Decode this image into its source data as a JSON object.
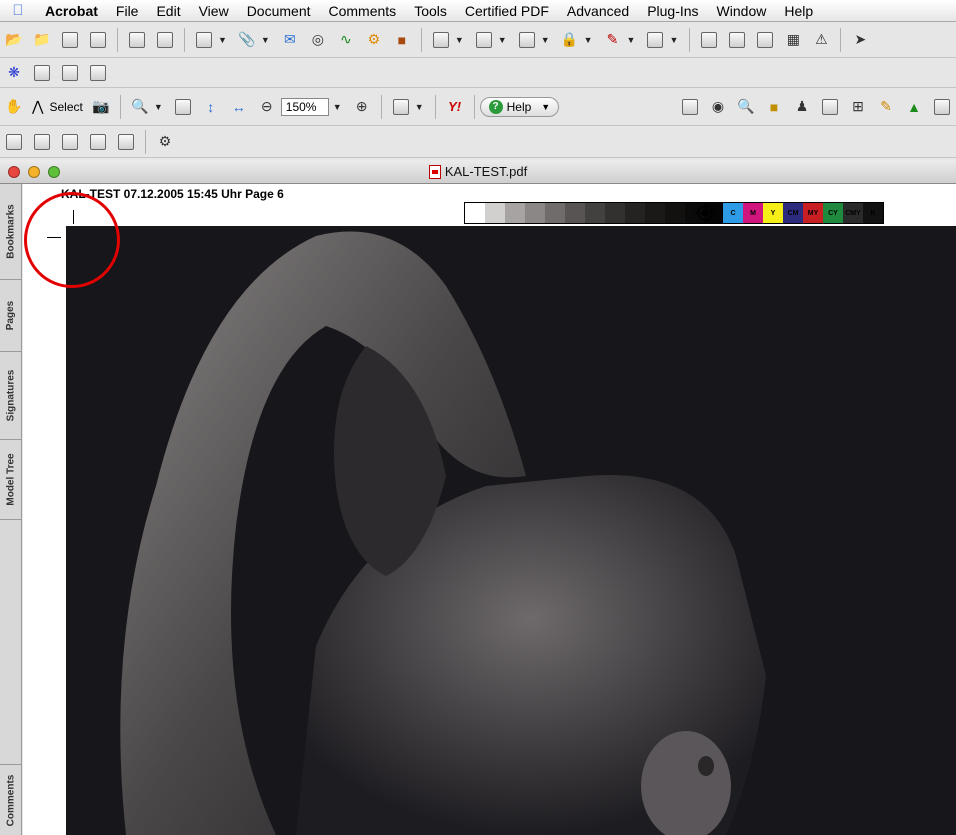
{
  "menubar": {
    "app": "Acrobat",
    "items": [
      "File",
      "Edit",
      "View",
      "Document",
      "Comments",
      "Tools",
      "Certified PDF",
      "Advanced",
      "Plug-Ins",
      "Window",
      "Help"
    ]
  },
  "toolbar": {
    "select_label": "Select",
    "zoom_value": "150%",
    "help_label": "Help",
    "yahoo_label": "Y!"
  },
  "window": {
    "title": "KAL-TEST.pdf"
  },
  "sidetabs": [
    "Bookmarks",
    "Pages",
    "Signatures",
    "Model Tree",
    "Comments"
  ],
  "page": {
    "slug_line": "KAL-TEST 07.12.2005 15:45 Uhr Page 6",
    "gray_patches": [
      "#ffffff",
      "#d2d0cf",
      "#a6a3a2",
      "#8a8786",
      "#6f6c6b",
      "#575453",
      "#434140",
      "#333130",
      "#252322",
      "#1a1918",
      "#121110",
      "#0b0a0a",
      "#050505",
      "#000000"
    ],
    "color_patches": [
      {
        "label": "C",
        "color": "#2e9be6"
      },
      {
        "label": "M",
        "color": "#d0157f"
      },
      {
        "label": "Y",
        "color": "#f6ee17"
      },
      {
        "label": "CM",
        "color": "#2c2b7e"
      },
      {
        "label": "MY",
        "color": "#c81f23"
      },
      {
        "label": "CY",
        "color": "#1f8a3e"
      },
      {
        "label": "CMY",
        "color": "#2a2a2a"
      },
      {
        "label": "K",
        "color": "#111111"
      }
    ]
  },
  "colors": {
    "annotation_circle": "#e30000",
    "photo_background": "#17161a"
  }
}
